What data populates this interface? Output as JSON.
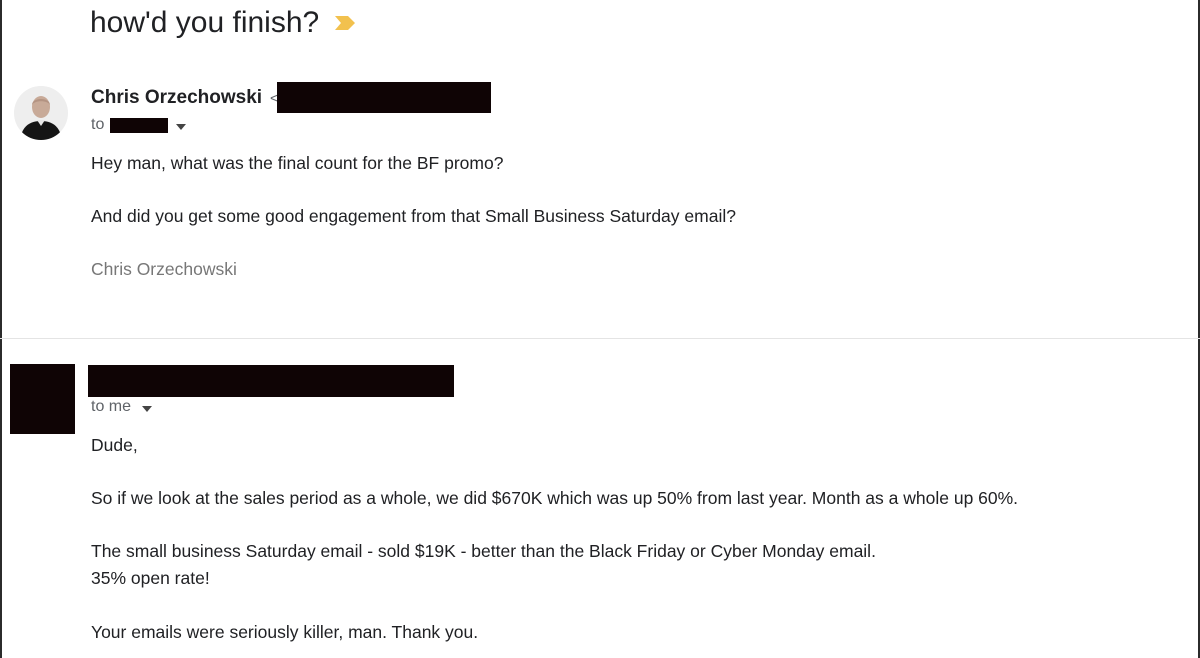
{
  "thread": {
    "subject": "how'd you finish?",
    "importance_icon": "importance-marker-icon",
    "importance_color": "#f2c14e"
  },
  "message1": {
    "sender_name": "Chris Orzechowski",
    "sender_email_prefix": "<",
    "to_label": "to",
    "body": [
      "Hey man, what was the final count for the BF promo?",
      "And did you get some good engagement from that Small Business Saturday email?"
    ],
    "signature": "Chris Orzechowski"
  },
  "message2": {
    "to_label": "to me",
    "body": [
      "Dude,",
      "So if we look at the sales period as a whole, we did $670K which was up 50% from last year. Month as a whole up 60%.",
      "The small business Saturday email - sold $19K - better than the Black Friday or Cyber Monday email.",
      "35% open rate!",
      "Your emails were seriously killer, man. Thank you."
    ]
  }
}
